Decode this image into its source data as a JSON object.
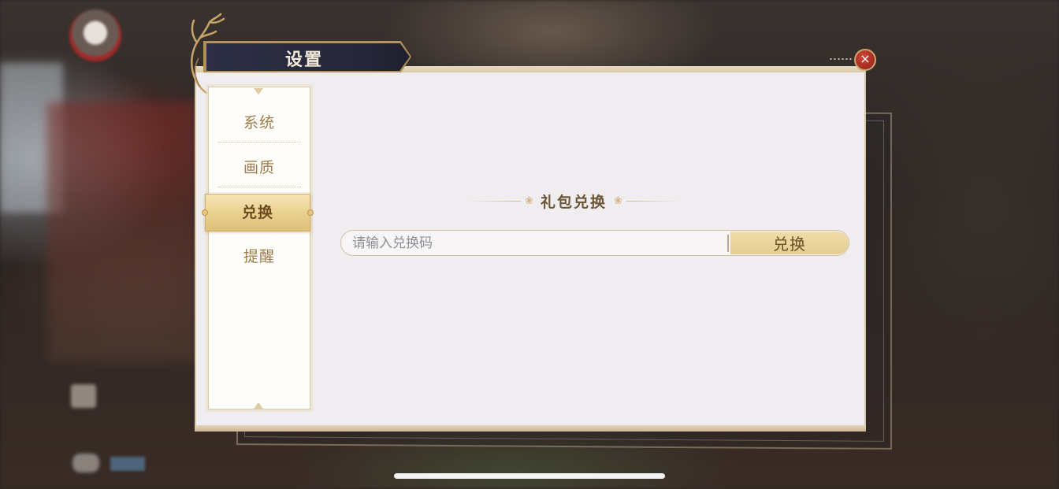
{
  "window": {
    "title": "设置",
    "close_label": "×"
  },
  "sidebar": {
    "items": [
      {
        "label": "系统",
        "active": false
      },
      {
        "label": "画质",
        "active": false
      },
      {
        "label": "兑换",
        "active": true
      },
      {
        "label": "提醒",
        "active": false
      }
    ]
  },
  "redeem": {
    "heading": "礼包兑换",
    "flower": "❀",
    "placeholder": "请输入兑换码",
    "value": "",
    "button_label": "兑换"
  },
  "colors": {
    "accent_gold": "#e5cd92",
    "text_brown": "#9c7c4c",
    "title_ribbon": "#2d2f45",
    "close_red": "#b8332a"
  }
}
